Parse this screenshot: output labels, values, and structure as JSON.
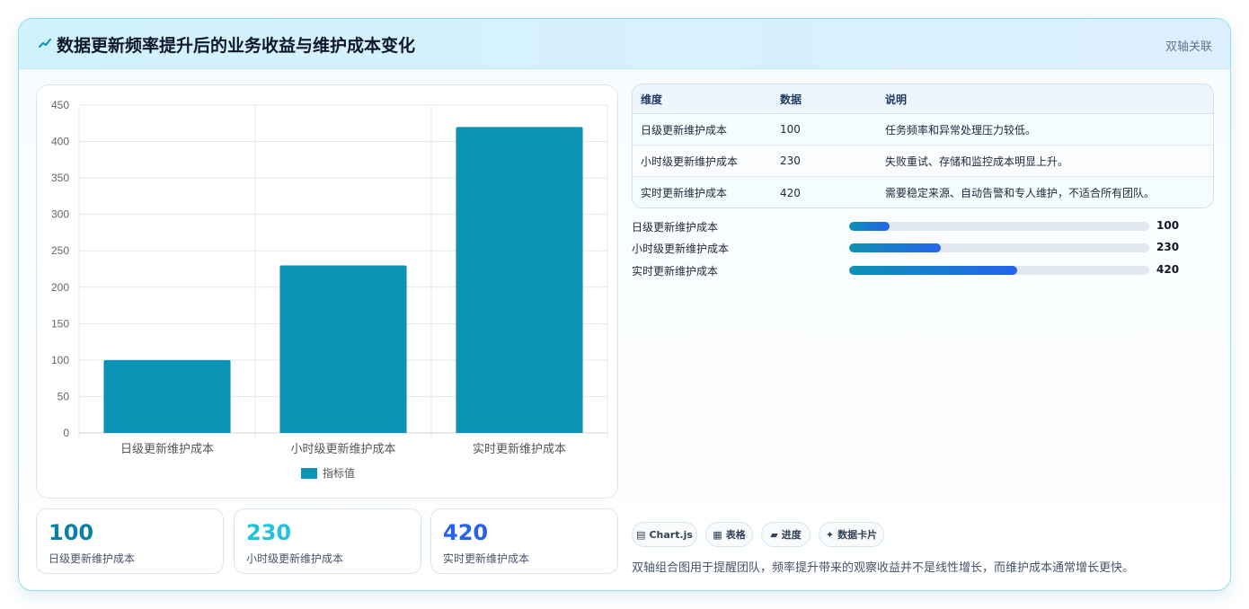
{
  "header": {
    "title": "数据更新频率提升后的业务收益与维护成本变化",
    "badge": "双轴关联",
    "icon": "chart-spark-icon"
  },
  "chart_data": {
    "type": "bar",
    "categories": [
      "日级更新维护成本",
      "小时级更新维护成本",
      "实时更新维护成本"
    ],
    "series": [
      {
        "name": "指标值",
        "values": [
          100,
          230,
          420
        ]
      }
    ],
    "ylim": [
      0,
      450
    ],
    "yticks": [
      0,
      50,
      100,
      150,
      200,
      250,
      300,
      350,
      400,
      450
    ],
    "legend": "bottom",
    "grid": true,
    "color": "#0b92b4"
  },
  "table": {
    "headers": [
      "维度",
      "数据",
      "说明"
    ],
    "rows": [
      {
        "dim": "日级更新维护成本",
        "value": "100",
        "desc": "任务频率和异常处理压力较低。"
      },
      {
        "dim": "小时级更新维护成本",
        "value": "230",
        "desc": "失败重试、存储和监控成本明显上升。"
      },
      {
        "dim": "实时更新维护成本",
        "value": "420",
        "desc": "需要稳定来源、自动告警和专人维护，不适合所有团队。"
      }
    ]
  },
  "progress": {
    "max": 750,
    "items": [
      {
        "label": "日级更新维护成本",
        "value": 100,
        "display": "100"
      },
      {
        "label": "小时级更新维护成本",
        "value": 230,
        "display": "230"
      },
      {
        "label": "实时更新维护成本",
        "value": 420,
        "display": "420"
      }
    ]
  },
  "stats": [
    {
      "value": "100",
      "label": "日级更新维护成本",
      "color": "#0b7fa8"
    },
    {
      "value": "230",
      "label": "小时级更新维护成本",
      "color": "#22c3d8"
    },
    {
      "value": "420",
      "label": "实时更新维护成本",
      "color": "#2563eb"
    }
  ],
  "chips": [
    {
      "icon": "chart-icon",
      "glyph": "▤",
      "label": "Chart.js"
    },
    {
      "icon": "table-icon",
      "glyph": "▦",
      "label": "表格"
    },
    {
      "icon": "progress-icon",
      "glyph": "▰",
      "label": "进度"
    },
    {
      "icon": "card-icon",
      "glyph": "✦",
      "label": "数据卡片"
    }
  ],
  "note": "双轴组合图用于提醒团队，频率提升带来的观察收益并不是线性增长，而维护成本通常增长更快。"
}
